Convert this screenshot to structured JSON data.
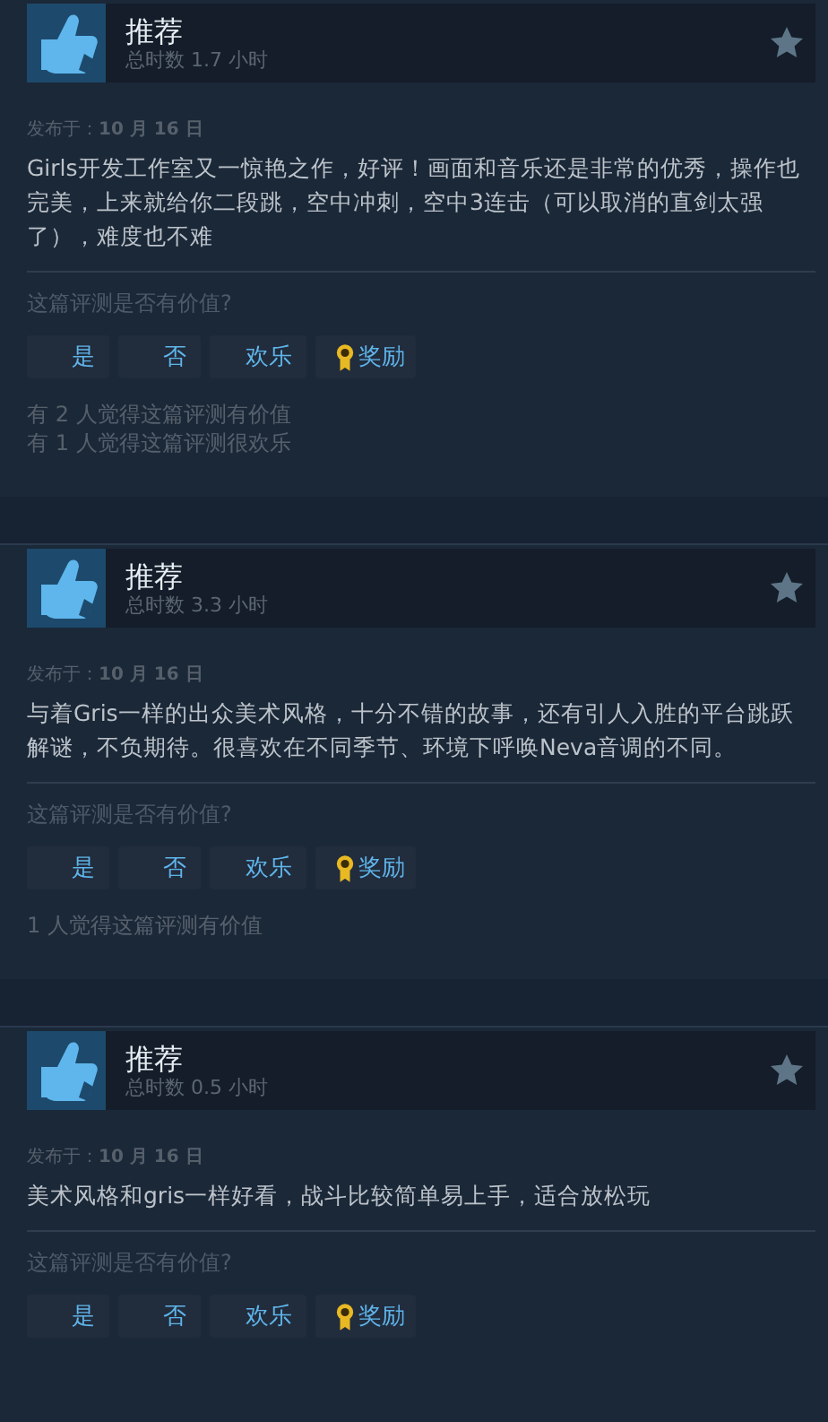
{
  "reviews": [
    {
      "verdict": "推荐",
      "hours": "总时数 1.7 小时",
      "posted_label": "发布于：",
      "posted_date": "10 月 16 日",
      "text": "Girls开发工作室又一惊艳之作，好评！画面和音乐还是非常的优秀，操作也完美，上来就给你二段跳，空中冲刺，空中3连击（可以取消的直剑太强了），难度也不难",
      "question": "这篇评测是否有价值?",
      "buttons": [
        {
          "label": "是",
          "kind": "vote"
        },
        {
          "label": "否",
          "kind": "vote"
        },
        {
          "label": "欢乐",
          "kind": "vote"
        },
        {
          "label": "奖励",
          "kind": "award"
        }
      ],
      "stats": [
        "有 2 人觉得这篇评测有价值",
        "有 1 人觉得这篇评测很欢乐"
      ]
    },
    {
      "verdict": "推荐",
      "hours": "总时数 3.3 小时",
      "posted_label": "发布于：",
      "posted_date": "10 月 16 日",
      "text": "与着Gris一样的出众美术风格，十分不错的故事，还有引人入胜的平台跳跃解谜，不负期待。很喜欢在不同季节、环境下呼唤Neva音调的不同。",
      "question": "这篇评测是否有价值?",
      "buttons": [
        {
          "label": "是",
          "kind": "vote"
        },
        {
          "label": "否",
          "kind": "vote"
        },
        {
          "label": "欢乐",
          "kind": "vote"
        },
        {
          "label": "奖励",
          "kind": "award"
        }
      ],
      "stats": [
        "1 人觉得这篇评测有价值"
      ]
    },
    {
      "verdict": "推荐",
      "hours": "总时数 0.5 小时",
      "posted_label": "发布于：",
      "posted_date": "10 月 16 日",
      "text": "美术风格和gris一样好看，战斗比较简单易上手，适合放松玩",
      "question": "这篇评测是否有价值?",
      "buttons": [
        {
          "label": "是",
          "kind": "vote"
        },
        {
          "label": "否",
          "kind": "vote"
        },
        {
          "label": "欢乐",
          "kind": "vote"
        },
        {
          "label": "奖励",
          "kind": "award"
        }
      ]
    }
  ]
}
